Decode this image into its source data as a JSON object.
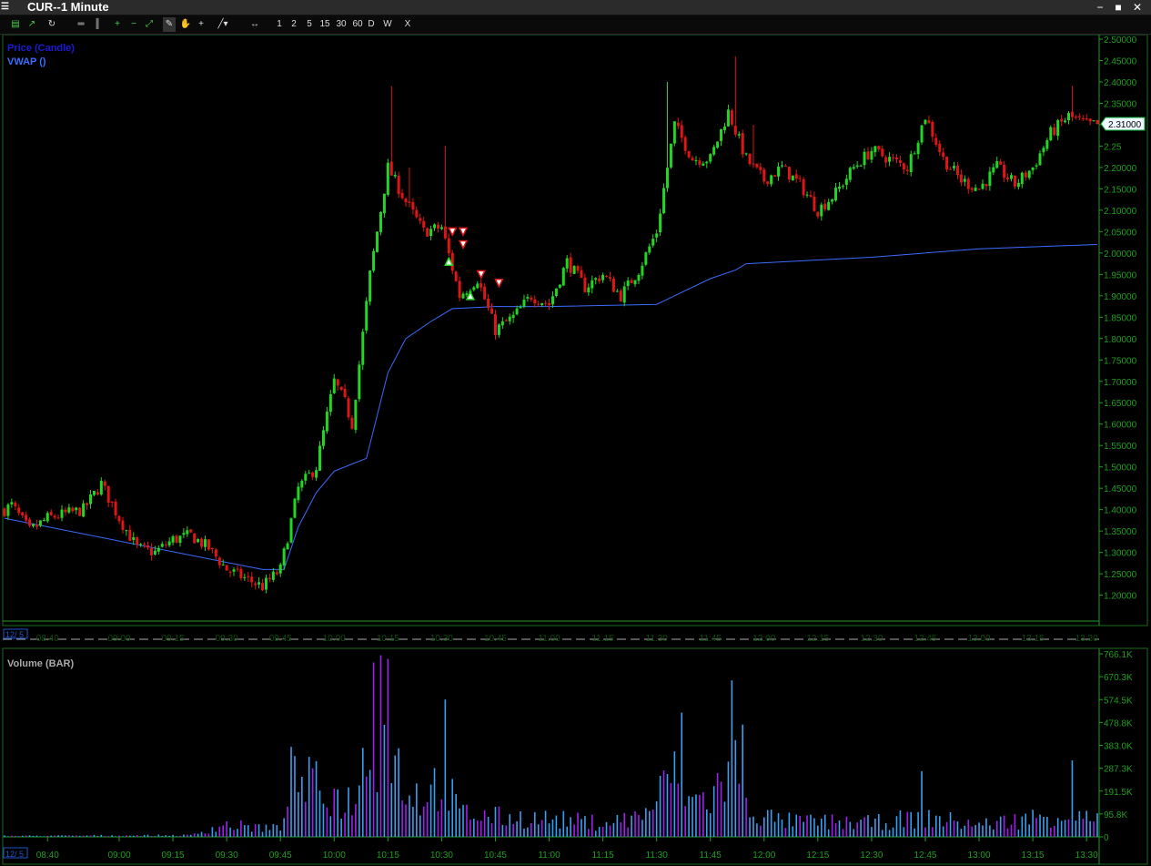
{
  "window": {
    "title": "CUR--1 Minute",
    "icon": "app-logo-icon",
    "minimize_icon": "minimize-icon",
    "maximize_icon": "maximize-icon",
    "close_icon": "close-icon"
  },
  "toolbar": {
    "icons": [
      "chart-type-icon",
      "indicator-icon",
      "refresh-icon",
      "horizontal-split-icon",
      "vertical-split-icon",
      "zoom-in-icon",
      "zoom-out-icon",
      "fit-icon",
      "draw-icon",
      "pan-hand-icon",
      "crosshair-icon",
      "trendline-icon",
      "scroll-arrows-icon"
    ],
    "periods": [
      "1",
      "2",
      "5",
      "15",
      "30",
      "60",
      "D",
      "W"
    ],
    "close_label": "X"
  },
  "price_pane": {
    "legend": [
      {
        "label": "Price (Candle)",
        "color": "#1a1ad6"
      },
      {
        "label": "VWAP ()",
        "color": "#3b6cff"
      }
    ],
    "y_ticks": [
      "2.50000",
      "2.45000",
      "2.40000",
      "2.35000",
      "2.30000",
      "2.25",
      "2.20000",
      "2.15000",
      "2.10000",
      "2.05000",
      "2.00000",
      "1.95000",
      "1.90000",
      "1.85000",
      "1.80000",
      "1.75000",
      "1.70000",
      "1.65000",
      "1.60000",
      "1.55000",
      "1.50000",
      "1.45000",
      "1.40000",
      "1.35000",
      "1.30000",
      "1.25000",
      "1.20000"
    ],
    "last_price": "2.31000",
    "date_label": "12/ 5"
  },
  "volume_pane": {
    "title": "Volume (BAR)",
    "y_ticks": [
      "766.1K",
      "670.3K",
      "574.5K",
      "478.8K",
      "383.0K",
      "287.3K",
      "191.5K",
      "95.8K",
      "0"
    ]
  },
  "x_axis": {
    "date_label": "12/ 5",
    "ticks": [
      "08:40",
      "09:00",
      "09:15",
      "09:30",
      "09:45",
      "10:00",
      "10:15",
      "10:30",
      "10:45",
      "11:00",
      "11:15",
      "11:30",
      "11:45",
      "12:00",
      "12:15",
      "12:30",
      "12:45",
      "13:00",
      "13:15",
      "13:30"
    ]
  },
  "colors": {
    "up": "#22d622",
    "down": "#e01515",
    "vwap": "#3b6cff",
    "axis": "#1f9f1f",
    "vol_blue": "#3a9ff0",
    "vol_purple": "#a020f0"
  },
  "chart_data": [
    {
      "type": "candlestick",
      "title": "Price (Candle)",
      "ylim": [
        1.18,
        2.5
      ],
      "x_range": [
        "08:28",
        "13:33"
      ],
      "anchors": [
        {
          "t": "08:28",
          "price": 1.4
        },
        {
          "t": "08:30",
          "price": 1.41
        },
        {
          "t": "08:35",
          "price": 1.35
        },
        {
          "t": "08:40",
          "price": 1.38
        },
        {
          "t": "08:50",
          "price": 1.4
        },
        {
          "t": "08:55",
          "price": 1.46
        },
        {
          "t": "09:00",
          "price": 1.38
        },
        {
          "t": "09:05",
          "price": 1.31
        },
        {
          "t": "09:10",
          "price": 1.3
        },
        {
          "t": "09:15",
          "price": 1.33
        },
        {
          "t": "09:20",
          "price": 1.34
        },
        {
          "t": "09:25",
          "price": 1.31
        },
        {
          "t": "09:30",
          "price": 1.26
        },
        {
          "t": "09:40",
          "price": 1.22
        },
        {
          "t": "09:45",
          "price": 1.26
        },
        {
          "t": "09:50",
          "price": 1.45
        },
        {
          "t": "09:55",
          "price": 1.5
        },
        {
          "t": "10:00",
          "price": 1.7
        },
        {
          "t": "10:03",
          "price": 1.65
        },
        {
          "t": "10:05",
          "price": 1.6
        },
        {
          "t": "10:10",
          "price": 1.95
        },
        {
          "t": "10:15",
          "price": 2.2
        },
        {
          "t": "10:20",
          "price": 2.12
        },
        {
          "t": "10:25",
          "price": 2.05
        },
        {
          "t": "10:30",
          "price": 2.06
        },
        {
          "t": "10:35",
          "price": 1.9
        },
        {
          "t": "10:40",
          "price": 1.94
        },
        {
          "t": "10:45",
          "price": 1.82
        },
        {
          "t": "10:50",
          "price": 1.85
        },
        {
          "t": "10:55",
          "price": 1.9
        },
        {
          "t": "11:00",
          "price": 1.88
        },
        {
          "t": "11:05",
          "price": 1.98
        },
        {
          "t": "11:10",
          "price": 1.92
        },
        {
          "t": "11:15",
          "price": 1.95
        },
        {
          "t": "11:20",
          "price": 1.9
        },
        {
          "t": "11:25",
          "price": 1.96
        },
        {
          "t": "11:30",
          "price": 2.05
        },
        {
          "t": "11:35",
          "price": 2.3
        },
        {
          "t": "11:40",
          "price": 2.22
        },
        {
          "t": "11:45",
          "price": 2.22
        },
        {
          "t": "11:50",
          "price": 2.33
        },
        {
          "t": "11:55",
          "price": 2.22
        },
        {
          "t": "12:00",
          "price": 2.17
        },
        {
          "t": "12:05",
          "price": 2.2
        },
        {
          "t": "12:10",
          "price": 2.16
        },
        {
          "t": "12:15",
          "price": 2.1
        },
        {
          "t": "12:20",
          "price": 2.14
        },
        {
          "t": "12:25",
          "price": 2.2
        },
        {
          "t": "12:30",
          "price": 2.24
        },
        {
          "t": "12:35",
          "price": 2.22
        },
        {
          "t": "12:40",
          "price": 2.2
        },
        {
          "t": "12:45",
          "price": 2.32
        },
        {
          "t": "12:50",
          "price": 2.22
        },
        {
          "t": "12:55",
          "price": 2.17
        },
        {
          "t": "13:00",
          "price": 2.15
        },
        {
          "t": "13:05",
          "price": 2.2
        },
        {
          "t": "13:10",
          "price": 2.16
        },
        {
          "t": "13:15",
          "price": 2.2
        },
        {
          "t": "13:20",
          "price": 2.28
        },
        {
          "t": "13:25",
          "price": 2.32
        },
        {
          "t": "13:30",
          "price": 2.3
        }
      ],
      "spikes": [
        {
          "t": "10:16",
          "high": 2.39
        },
        {
          "t": "10:21",
          "high": 2.2
        },
        {
          "t": "10:31",
          "high": 2.25
        },
        {
          "t": "11:33",
          "high": 2.4
        },
        {
          "t": "11:52",
          "high": 2.46
        },
        {
          "t": "11:57",
          "high": 2.3
        },
        {
          "t": "13:26",
          "high": 2.39
        }
      ],
      "vwap": [
        {
          "t": "08:28",
          "price": 1.38
        },
        {
          "t": "09:40",
          "price": 1.26
        },
        {
          "t": "09:46",
          "price": 1.26
        },
        {
          "t": "09:50",
          "price": 1.36
        },
        {
          "t": "09:55",
          "price": 1.44
        },
        {
          "t": "10:00",
          "price": 1.49
        },
        {
          "t": "10:09",
          "price": 1.52
        },
        {
          "t": "10:15",
          "price": 1.72
        },
        {
          "t": "10:20",
          "price": 1.8
        },
        {
          "t": "10:27",
          "price": 1.84
        },
        {
          "t": "10:33",
          "price": 1.87
        },
        {
          "t": "10:45",
          "price": 1.875
        },
        {
          "t": "11:00",
          "price": 1.875
        },
        {
          "t": "11:30",
          "price": 1.88
        },
        {
          "t": "11:35",
          "price": 1.9
        },
        {
          "t": "11:45",
          "price": 1.94
        },
        {
          "t": "11:52",
          "price": 1.96
        },
        {
          "t": "11:55",
          "price": 1.975
        },
        {
          "t": "12:30",
          "price": 1.99
        },
        {
          "t": "13:00",
          "price": 2.01
        },
        {
          "t": "13:33",
          "price": 2.02
        }
      ],
      "buy_signals": [
        {
          "t": "10:32",
          "price": 1.98
        },
        {
          "t": "10:38",
          "price": 1.9
        }
      ],
      "sell_signals": [
        {
          "t": "10:33",
          "price": 2.05
        },
        {
          "t": "10:36",
          "price": 2.05
        },
        {
          "t": "10:36",
          "price": 2.02
        },
        {
          "t": "10:41",
          "price": 1.95
        },
        {
          "t": "10:46",
          "price": 1.93
        }
      ],
      "last": 2.31
    },
    {
      "type": "bar",
      "title": "Volume (BAR)",
      "ylim": [
        0,
        766100
      ],
      "volume_anchors": [
        {
          "t": "08:28",
          "v": 5000
        },
        {
          "t": "09:20",
          "v": 8000
        },
        {
          "t": "09:29",
          "v": 60000
        },
        {
          "t": "09:45",
          "v": 40000
        },
        {
          "t": "09:47",
          "v": 300000
        },
        {
          "t": "09:55",
          "v": 250000
        },
        {
          "t": "10:00",
          "v": 200000
        },
        {
          "t": "10:05",
          "v": 180000
        },
        {
          "t": "10:10",
          "v": 480000
        },
        {
          "t": "10:15",
          "v": 500000
        },
        {
          "t": "10:20",
          "v": 250000
        },
        {
          "t": "10:25",
          "v": 200000
        },
        {
          "t": "10:30",
          "v": 300000
        },
        {
          "t": "10:35",
          "v": 120000
        },
        {
          "t": "10:45",
          "v": 100000
        },
        {
          "t": "11:00",
          "v": 90000
        },
        {
          "t": "11:15",
          "v": 70000
        },
        {
          "t": "11:25",
          "v": 100000
        },
        {
          "t": "11:30",
          "v": 180000
        },
        {
          "t": "11:35",
          "v": 350000
        },
        {
          "t": "11:40",
          "v": 180000
        },
        {
          "t": "11:45",
          "v": 200000
        },
        {
          "t": "11:52",
          "v": 350000
        },
        {
          "t": "11:57",
          "v": 120000
        },
        {
          "t": "12:05",
          "v": 80000
        },
        {
          "t": "12:30",
          "v": 70000
        },
        {
          "t": "12:45",
          "v": 100000
        },
        {
          "t": "13:00",
          "v": 60000
        },
        {
          "t": "13:25",
          "v": 120000
        },
        {
          "t": "13:33",
          "v": 80000
        }
      ],
      "volume_spikes": [
        {
          "t": "10:11",
          "v": 730000
        },
        {
          "t": "10:13",
          "v": 760000
        },
        {
          "t": "10:15",
          "v": 745000
        },
        {
          "t": "10:31",
          "v": 575000
        },
        {
          "t": "11:37",
          "v": 520000
        },
        {
          "t": "11:51",
          "v": 655000
        },
        {
          "t": "11:54",
          "v": 470000
        },
        {
          "t": "12:44",
          "v": 275000
        },
        {
          "t": "13:26",
          "v": 320000
        }
      ]
    }
  ]
}
